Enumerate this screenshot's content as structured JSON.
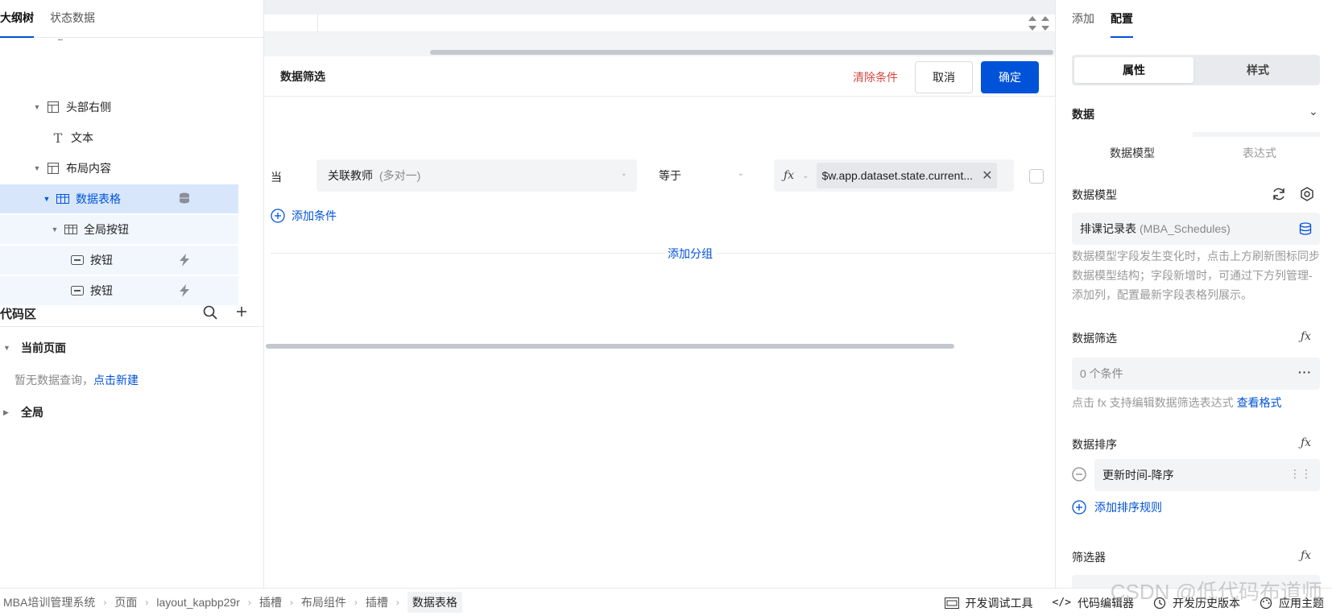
{
  "left": {
    "tabs": [
      "大纲树",
      "状态数据"
    ],
    "tree": [
      {
        "label": "头部右侧"
      },
      {
        "label": "文本"
      },
      {
        "label": "布局内容"
      },
      {
        "label": "数据表格"
      },
      {
        "label": "全局按钮"
      },
      {
        "label": "按钮"
      },
      {
        "label": "按钮"
      }
    ],
    "code": {
      "title": "代码区",
      "current_page": "当前页面",
      "empty_text": "暂无数据查询，",
      "create_link": "点击新建",
      "global": "全局"
    }
  },
  "filter": {
    "title": "数据筛选",
    "clear": "清除条件",
    "cancel": "取消",
    "ok": "确定",
    "when": "当",
    "field": "关联教师",
    "field_hint": "(多对一)",
    "operator": "等于",
    "value_tag": "$w.app.dataset.state.current...",
    "add_condition": "添加条件",
    "add_group": "添加分组"
  },
  "right": {
    "tabs": [
      "添加",
      "配置"
    ],
    "seg": [
      "属性",
      "样式"
    ],
    "data_title": "数据",
    "data_subtabs": [
      "数据模型",
      "表达式"
    ],
    "model_label": "数据模型",
    "model_name": "排课记录表",
    "model_code": "(MBA_Schedules)",
    "model_help": "数据模型字段发生变化时，点击上方刷新图标同步数据模型结构；字段新增时，可通过下方列管理-添加列，配置最新字段表格列展示。",
    "filter_label": "数据筛选",
    "filter_value": "0 个条件",
    "filter_help": "点击 fx 支持编辑数据筛选表达式",
    "filter_help_link": "查看格式",
    "sort_label": "数据排序",
    "sort_item": "更新时间-降序",
    "add_sort": "添加排序规则",
    "selector_label": "筛选器"
  },
  "footer": {
    "crumbs": [
      "MBA培训管理系统",
      "页面",
      "layout_kapbp29r",
      "插槽",
      "布局组件",
      "插槽",
      "数据表格"
    ],
    "tools": [
      "开发调试工具",
      "代码编辑器",
      "开发历史版本",
      "应用主题"
    ]
  },
  "watermark": "CSDN @低代码布道师",
  "colors": {
    "accent": "#0052d9",
    "danger": "#d54941",
    "selected": "#d7e6fb"
  }
}
